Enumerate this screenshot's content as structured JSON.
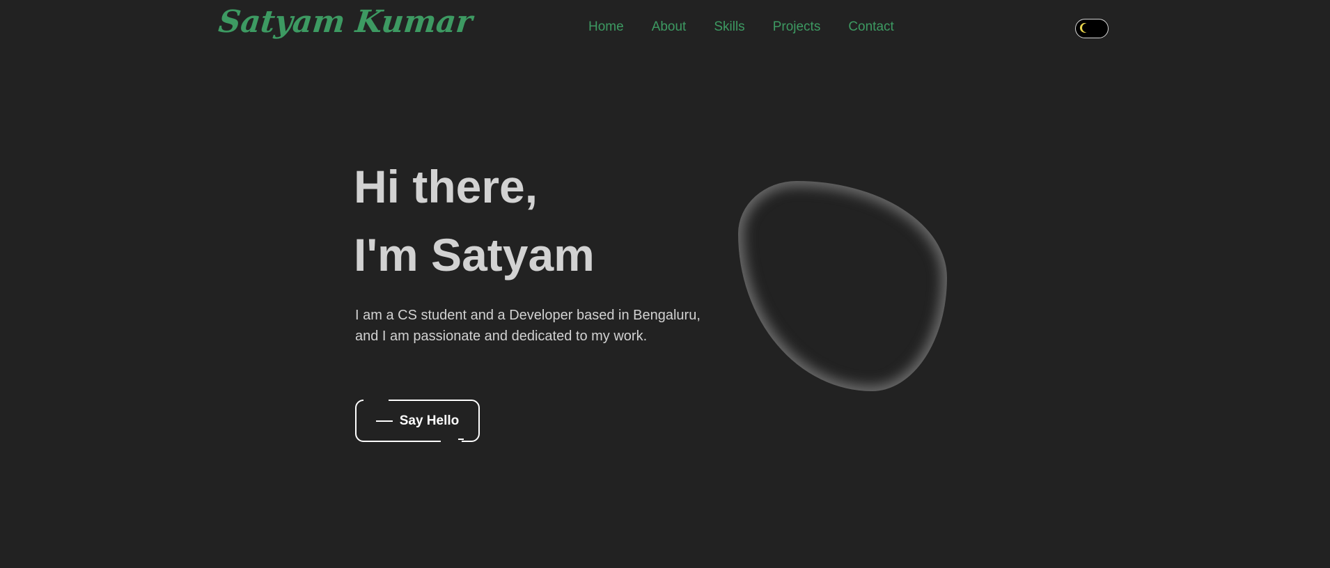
{
  "header": {
    "logo_text": "Satyam Kumar",
    "nav": [
      {
        "label": "Home"
      },
      {
        "label": "About"
      },
      {
        "label": "Skills"
      },
      {
        "label": "Projects"
      },
      {
        "label": "Contact"
      }
    ],
    "theme_toggle": {
      "icon": "moon-icon"
    }
  },
  "hero": {
    "line1": "Hi there,",
    "line2": "I'm Satyam",
    "intro": "I am a CS student and a Developer based in Bengaluru, and I am passionate and dedicated to my work.",
    "cta_label": "Say Hello"
  },
  "colors": {
    "background": "#222222",
    "accent": "#3d9a62",
    "text": "#d2d2d2",
    "moon": "#e8d44d"
  }
}
